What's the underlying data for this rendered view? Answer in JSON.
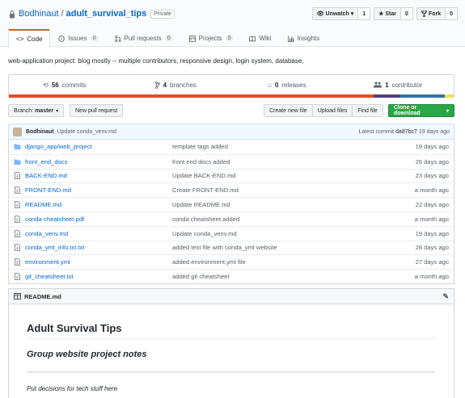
{
  "header": {
    "owner": "Bodhinaut",
    "separator": "/",
    "repo": "adult_survival_tips",
    "visibility": "Private",
    "actions": [
      {
        "label": "Unwatch",
        "count": "1",
        "icon": "eye-icon",
        "caret": true
      },
      {
        "label": "Star",
        "count": "0",
        "icon": "star-icon"
      },
      {
        "label": "Fork",
        "count": "0",
        "icon": "fork-icon"
      }
    ]
  },
  "tabs": [
    {
      "label": "Code",
      "icon": "code-icon",
      "active": true
    },
    {
      "label": "Issues",
      "count": "0",
      "icon": "issue-icon"
    },
    {
      "label": "Pull requests",
      "count": "0",
      "icon": "pull-request-icon"
    },
    {
      "label": "Projects",
      "count": "0",
      "icon": "project-icon"
    },
    {
      "label": "Wiki",
      "icon": "wiki-icon"
    },
    {
      "label": "Insights",
      "icon": "graph-icon"
    }
  ],
  "description": "web-application project: blog mostly -- multiple contributors, responsive design, login system, database,",
  "summary": {
    "commits": {
      "count": "56",
      "label": "commits"
    },
    "branches": {
      "count": "4",
      "label": "branches"
    },
    "releases": {
      "count": "0",
      "label": "releases"
    },
    "contributors": {
      "count": "1",
      "label": "contributor"
    },
    "language_colors": [
      "#e34c26",
      "#563d7c",
      "#3572A5",
      "#f1e05a"
    ]
  },
  "filenav": {
    "branch_label": "Branch:",
    "branch": "master",
    "new_pr": "New pull request",
    "create_file": "Create new file",
    "upload_files": "Upload files",
    "find_file": "Find file",
    "clone": "Clone or download"
  },
  "latest_commit": {
    "author": "Bodhinaut",
    "message": "Update conda_venv.md",
    "prefix": "Latest commit",
    "sha": "da87bc7",
    "age": "19 days ago"
  },
  "files": [
    {
      "name": "django_app/web_project",
      "type": "dir",
      "message": "template tags added",
      "age": "19 days ago"
    },
    {
      "name": "front_end_docs",
      "type": "dir",
      "message": "front end docs added",
      "age": "26 days ago"
    },
    {
      "name": "BACK-END.md",
      "type": "file",
      "message": "Update BACK-END.md",
      "age": "23 days ago"
    },
    {
      "name": "FRONT-END.md",
      "type": "file",
      "message": "Create FRONT-END.md",
      "age": "a month ago"
    },
    {
      "name": "README.md",
      "type": "file",
      "message": "Update README.md",
      "age": "22 days ago"
    },
    {
      "name": "conda-cheatsheet.pdf",
      "type": "file",
      "message": "conda cheatsheet added",
      "age": "a month ago"
    },
    {
      "name": "conda_venv.md",
      "type": "file",
      "message": "Update conda_venv.md",
      "age": "19 days ago"
    },
    {
      "name": "conda_yml_info.txt.txt",
      "type": "file",
      "message": "added text file with conda_yml website",
      "age": "28 days ago"
    },
    {
      "name": "environment.yml",
      "type": "file",
      "message": "added environment.yml file",
      "age": "27 days ago"
    },
    {
      "name": "git_cheatsheet.txt",
      "type": "file",
      "message": "added git cheatsheet",
      "age": "a month ago"
    }
  ],
  "readme": {
    "filename": "README.md",
    "h1": "Adult Survival Tips",
    "h2": "Group website project notes",
    "paragraph": "Put decisions for tech stuff here"
  }
}
